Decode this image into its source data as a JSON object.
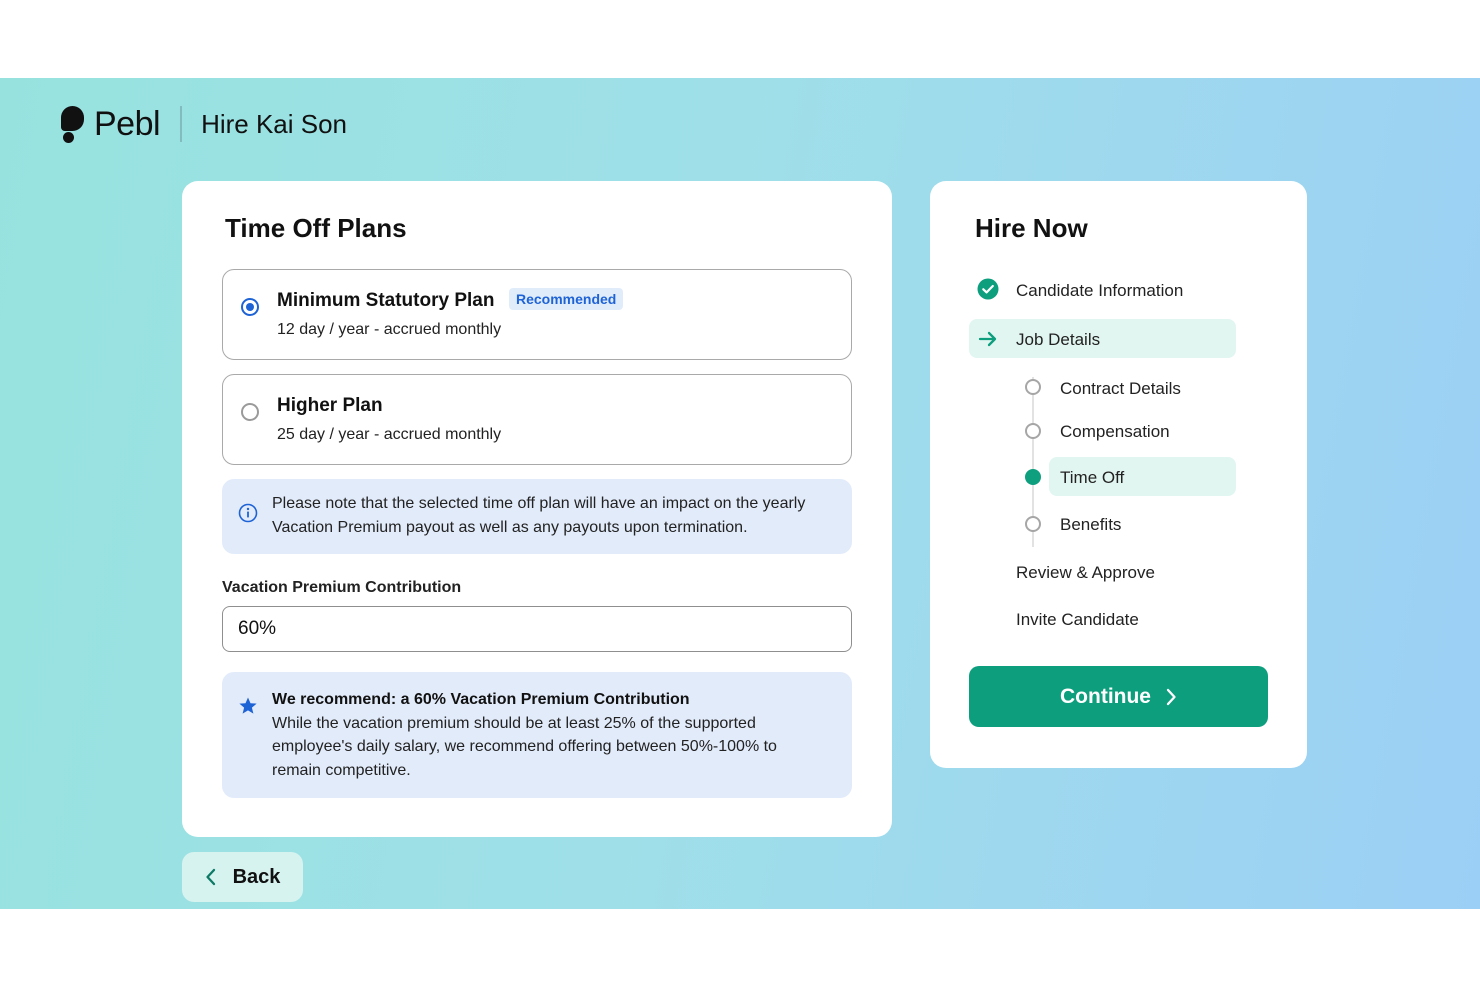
{
  "brand": {
    "logo": "Pebl",
    "title": "Hire Kai Son"
  },
  "time_off": {
    "title": "Time Off Plans",
    "plans": [
      {
        "name": "Minimum Statutory Plan",
        "badge": "Recommended",
        "desc": "12 day / year - accrued monthly",
        "selected": true
      },
      {
        "name": "Higher Plan",
        "desc": "25 day / year - accrued monthly",
        "selected": false
      }
    ],
    "note": "Please note that the selected time off plan will have an impact on the yearly Vacation Premium payout as well as any payouts upon termination.",
    "contribution_label": "Vacation Premium Contribution",
    "contribution_value": "60%",
    "recommendation_title": "We recommend: a 60% Vacation Premium Contribution",
    "recommendation_body": "While the vacation premium should be at least 25% of the supported employee's daily salary, we recommend offering between 50%-100% to remain competitive."
  },
  "hire_now": {
    "title": "Hire Now",
    "steps": [
      {
        "label": "Candidate Information",
        "status": "complete"
      },
      {
        "label": "Job Details",
        "status": "current"
      },
      {
        "label": "Review & Approve",
        "status": "pending"
      },
      {
        "label": "Invite Candidate",
        "status": "pending"
      }
    ],
    "substeps": [
      {
        "label": "Contract Details",
        "status": "pending"
      },
      {
        "label": "Compensation",
        "status": "pending"
      },
      {
        "label": "Time Off",
        "status": "active"
      },
      {
        "label": "Benefits",
        "status": "pending"
      }
    ],
    "continue_label": "Continue"
  },
  "back_label": "Back",
  "colors": {
    "accent_green": "#0d9e7e",
    "accent_blue": "#1e63d6",
    "note_bg": "#e2ebfa",
    "highlight_bg": "#e2f6f1"
  },
  "icons": [
    "check-circle-icon",
    "arrow-right-icon",
    "info-icon",
    "star-icon",
    "chevron-right-icon",
    "chevron-left-icon"
  ]
}
